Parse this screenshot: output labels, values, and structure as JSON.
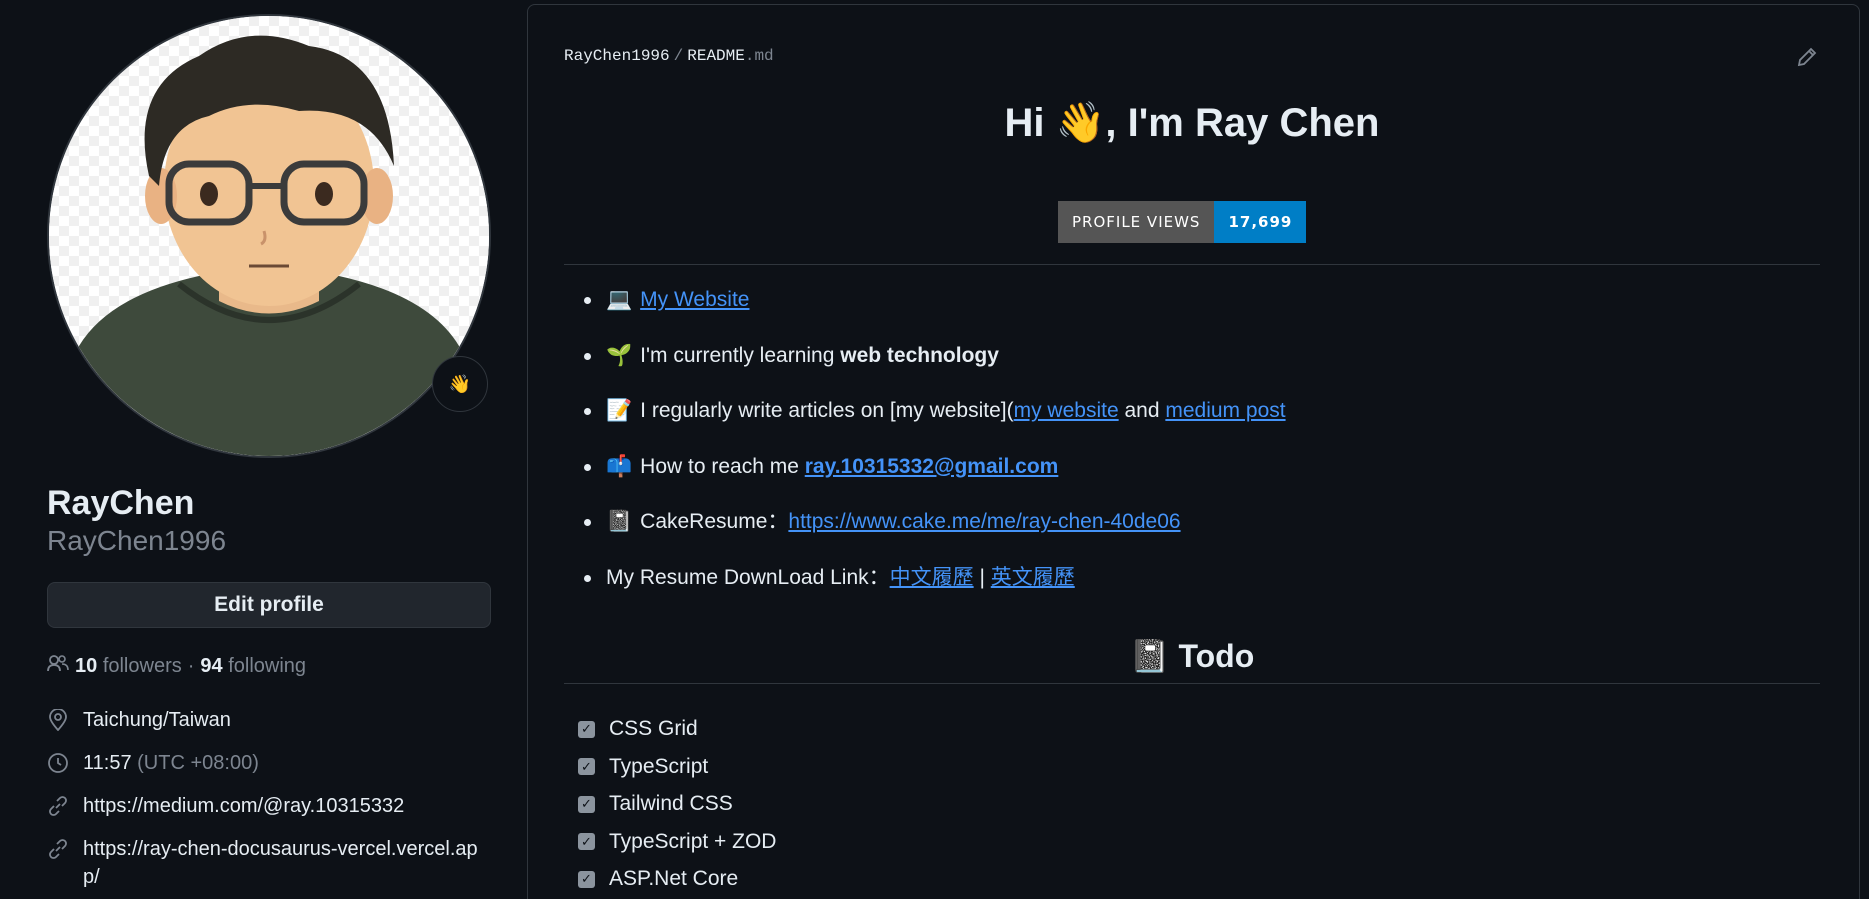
{
  "profile": {
    "status_emoji": "👋",
    "full_name": "RayChen",
    "login": "RayChen1996",
    "edit_label": "Edit profile",
    "followers_count": "10",
    "followers_label": "followers",
    "dot": "·",
    "following_count": "94",
    "following_label": "following",
    "location": "Taichung/Taiwan",
    "local_time": "11:57",
    "timezone": "(UTC +08:00)",
    "links": [
      "https://medium.com/@ray.10315332",
      "https://ray-chen-docusaurus-vercel.vercel.app/"
    ]
  },
  "readme": {
    "owner": "RayChen1996",
    "sep": "/",
    "file_base": "README",
    "file_ext": ".md",
    "title": "Hi 👋, I'm Ray Chen",
    "badge_label": "PROFILE VIEWS",
    "badge_value": "17,699",
    "items": {
      "website_emoji": "💻",
      "website_link": "My Website",
      "learning_emoji": "🌱",
      "learning_text": "I'm currently learning ",
      "learning_bold": "web technology",
      "articles_emoji": "📝",
      "articles_text": "I regularly write articles on [my website](",
      "articles_link1": "my website",
      "articles_and": " and ",
      "articles_link2": "medium post",
      "reach_emoji": "📫",
      "reach_text": "How to reach me ",
      "reach_email": "ray.10315332@gmail.com",
      "cake_emoji": "📓",
      "cake_text": "CakeResume：",
      "cake_link": "https://www.cake.me/me/ray-chen-40de06",
      "resume_text": "My Resume DownLoad Link：",
      "resume_zh": "中文履歷",
      "resume_sep": " | ",
      "resume_en": "英文履歷"
    },
    "todo_title": "📓 Todo",
    "todo_items": [
      "CSS Grid",
      "TypeScript",
      "Tailwind CSS",
      "TypeScript + ZOD",
      "ASP.Net Core"
    ]
  },
  "icons": [
    "people-icon",
    "location-icon",
    "clock-icon",
    "link-icon",
    "pencil-icon",
    "check-icon"
  ]
}
